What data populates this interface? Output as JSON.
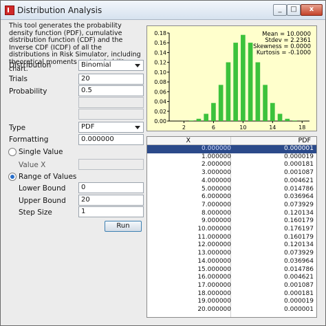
{
  "window": {
    "title": "Distribution Analysis",
    "min_label": "_",
    "max_label": "□",
    "close_label": "x"
  },
  "description": "This tool generates the probability density function (PDF), cumulative distribution function (CDF) and the Inverse CDF (ICDF) of all the distributions in Risk Simulator, including theoretical moments and probability chart.",
  "form": {
    "distribution_label": "Distribution",
    "distribution_value": "Binomial",
    "trials_label": "Trials",
    "trials_value": "20",
    "probability_label": "Probability",
    "probability_value": "0.5",
    "type_label": "Type",
    "type_value": "PDF",
    "formatting_label": "Formatting",
    "formatting_value": "0.000000",
    "single_value_label": "Single Value",
    "value_x_label": "Value X",
    "range_label": "Range of Values",
    "lower_bound_label": "Lower Bound",
    "lower_bound_value": "0",
    "upper_bound_label": "Upper Bound",
    "upper_bound_value": "20",
    "step_size_label": "Step Size",
    "step_size_value": "1",
    "run_label": "Run"
  },
  "stats": {
    "mean": "Mean = 10.0000",
    "stdev": "Stdev = 2.2361",
    "skewness": "Skewness = 0.0000",
    "kurtosis": "Kurtosis = -0.1000"
  },
  "table": {
    "col_x": "X",
    "col_pdf": "PDF",
    "rows": [
      [
        "0.000000",
        "0.000001"
      ],
      [
        "1.000000",
        "0.000019"
      ],
      [
        "2.000000",
        "0.000181"
      ],
      [
        "3.000000",
        "0.001087"
      ],
      [
        "4.000000",
        "0.004621"
      ],
      [
        "5.000000",
        "0.014786"
      ],
      [
        "6.000000",
        "0.036964"
      ],
      [
        "7.000000",
        "0.073929"
      ],
      [
        "8.000000",
        "0.120134"
      ],
      [
        "9.000000",
        "0.160179"
      ],
      [
        "10.000000",
        "0.176197"
      ],
      [
        "11.000000",
        "0.160179"
      ],
      [
        "12.000000",
        "0.120134"
      ],
      [
        "13.000000",
        "0.073929"
      ],
      [
        "14.000000",
        "0.036964"
      ],
      [
        "15.000000",
        "0.014786"
      ],
      [
        "16.000000",
        "0.004621"
      ],
      [
        "17.000000",
        "0.001087"
      ],
      [
        "18.000000",
        "0.000181"
      ],
      [
        "19.000000",
        "0.000019"
      ],
      [
        "20.000000",
        "0.000001"
      ]
    ]
  },
  "chart_data": {
    "type": "bar",
    "x": [
      0,
      1,
      2,
      3,
      4,
      5,
      6,
      7,
      8,
      9,
      10,
      11,
      12,
      13,
      14,
      15,
      16,
      17,
      18,
      19,
      20
    ],
    "values": [
      1e-06,
      1.9e-05,
      0.000181,
      0.001087,
      0.004621,
      0.014786,
      0.036964,
      0.073929,
      0.120134,
      0.160179,
      0.176197,
      0.160179,
      0.120134,
      0.073929,
      0.036964,
      0.014786,
      0.004621,
      0.001087,
      0.000181,
      1.9e-05,
      1e-06
    ],
    "ylim": [
      0,
      0.18
    ],
    "xlim": [
      0,
      19
    ],
    "y_ticks": [
      "0.18",
      "0.16",
      "0.14",
      "0.12",
      "0.10",
      "0.08",
      "0.06",
      "0.04",
      "0.02",
      "0.00"
    ],
    "x_ticks": [
      "2",
      "6",
      "10",
      "14",
      "18"
    ],
    "bar_color": "#3cc23c",
    "background": "#ffffcc"
  }
}
